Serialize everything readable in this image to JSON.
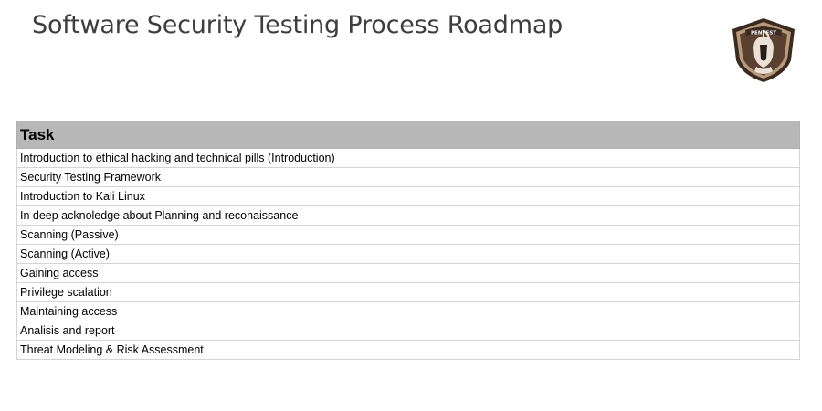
{
  "header": {
    "title": "Software Security Testing Process Roadmap",
    "logo": {
      "icon": "pentest-shield-icon",
      "text": "PENTEST",
      "colors": {
        "outer": "#3b2a20",
        "rim": "#b79a7a",
        "inner": "#5a4030"
      }
    }
  },
  "table": {
    "header_color": "#b8b8b8",
    "columns": [
      "Task"
    ],
    "rows": [
      "Introduction to ethical hacking and technical pills (Introduction)",
      "Security Testing Framework",
      "Introduction to Kali Linux",
      "In deep acknoledge about Planning and reconaissance",
      "Scanning (Passive)",
      "Scanning (Active)",
      "Gaining access",
      "Privilege scalation",
      "Maintaining access",
      "Analisis and report",
      "Threat Modeling & Risk Assessment"
    ]
  }
}
